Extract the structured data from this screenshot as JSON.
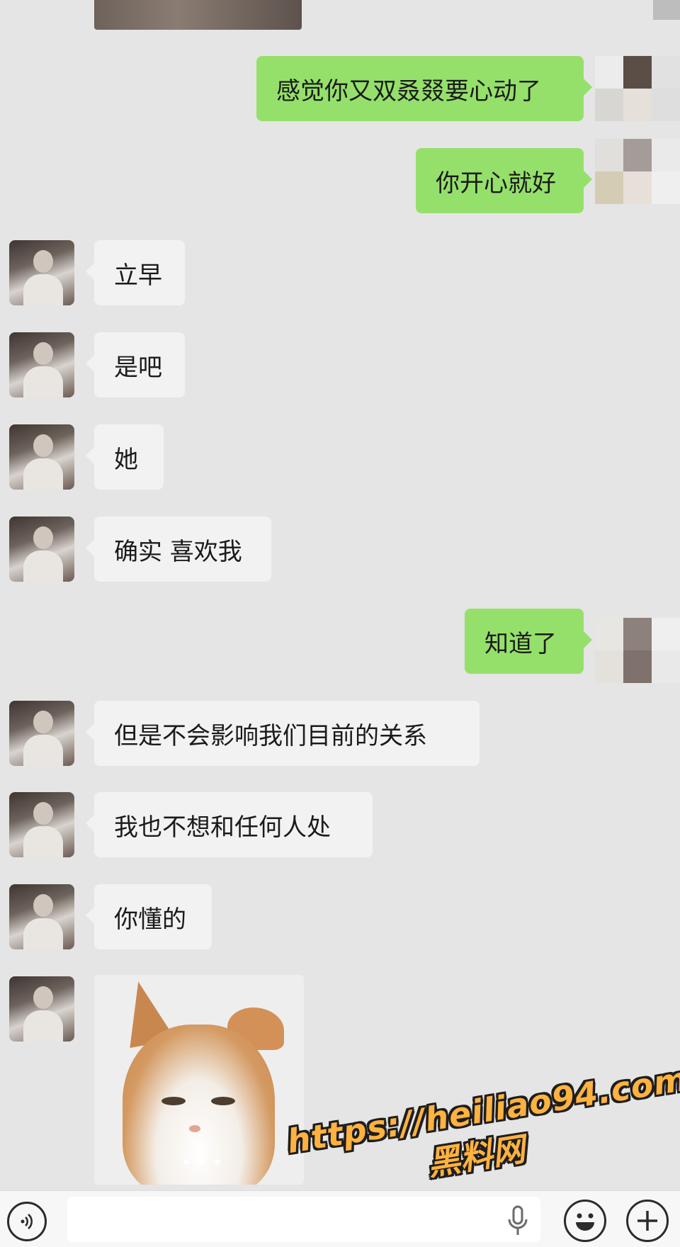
{
  "messages": [
    {
      "side": "out",
      "text": "感觉你又双叒叕要心动了"
    },
    {
      "side": "out",
      "text": "你开心就好"
    },
    {
      "side": "in",
      "text": "立早"
    },
    {
      "side": "in",
      "text": "是吧"
    },
    {
      "side": "in",
      "text": "她"
    },
    {
      "side": "in",
      "text": "确实 喜欢我"
    },
    {
      "side": "out",
      "text": "知道了"
    },
    {
      "side": "in",
      "text": "但是不会影响我们目前的关系"
    },
    {
      "side": "in",
      "text": "我也不想和任何人处"
    },
    {
      "side": "in",
      "text": "你懂的"
    }
  ],
  "sticker": {
    "type": "cat-sticker"
  },
  "watermark": {
    "url": "https://heiliao94.com",
    "name": "黑料网"
  },
  "input_bar": {
    "icons": [
      "voice-icon",
      "mic-icon",
      "emoji-icon",
      "plus-icon"
    ]
  },
  "colors": {
    "outgoing_bubble": "#95e06b",
    "incoming_bubble": "#f2f2f2",
    "background": "#e5e5e5"
  }
}
